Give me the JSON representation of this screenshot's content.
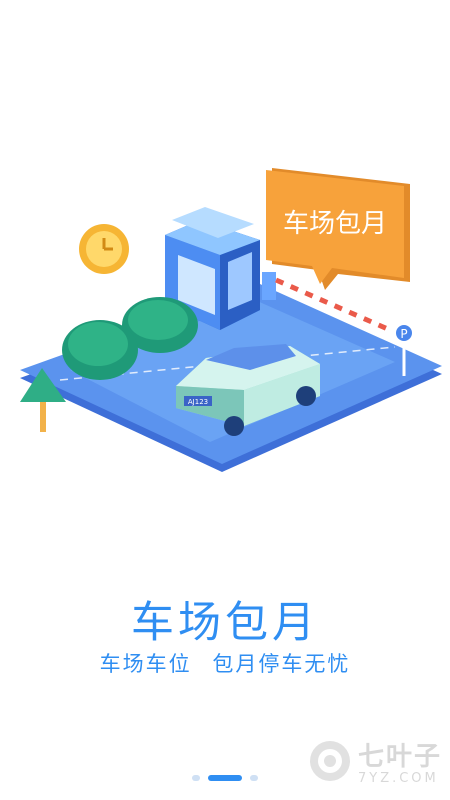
{
  "onboarding": {
    "title": "车场包月",
    "subtitle": "车场车位  包月停车无忧",
    "illustration_sign": "车场包月",
    "license_plate": "AJ123",
    "pager": {
      "total": 3,
      "active_index": 1
    }
  },
  "watermark": {
    "brand": "七叶子",
    "domain": "7YZ.COM"
  },
  "colors": {
    "accent": "#2f8ef2",
    "sign_orange": "#f7a23b",
    "ground_blue": "#4a86ec",
    "car_teal": "#d5f4ee",
    "bush_green": "#1f9a78"
  },
  "icons": {
    "clock": "clock-icon",
    "parking": "parking-sign-icon"
  }
}
